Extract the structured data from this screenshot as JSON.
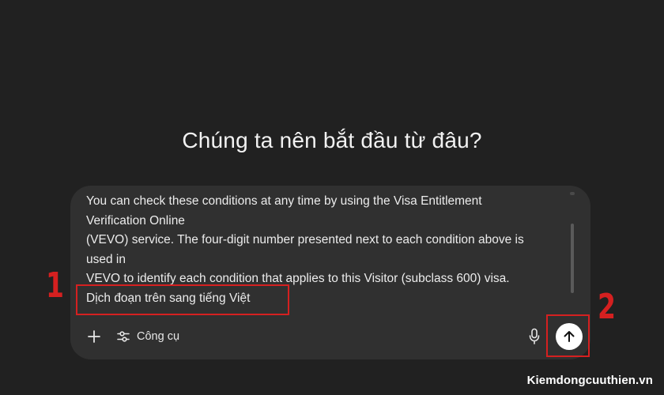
{
  "main": {
    "heading": "Chúng ta nên bắt đầu từ đâu?"
  },
  "composer": {
    "prompt_lines": [
      "You can check these conditions at any time by using the Visa Entitlement",
      "Verification Online",
      "(VEVO) service. The four-digit number presented next to each condition above is",
      "used in",
      "VEVO to identify each condition that applies to this Visitor (subclass 600) visa.",
      "Dịch đoạn trên sang tiếng Việt"
    ],
    "tools_label": "Công cụ",
    "icons": {
      "add": "plus-icon",
      "tools": "sliders-icon",
      "mic": "microphone-icon",
      "send": "arrow-up-icon"
    }
  },
  "annotations": {
    "step_1": "1",
    "step_2": "2",
    "color": "#d52020"
  },
  "watermark": "Kiemdongcuuthien.vn",
  "colors": {
    "background": "#212121",
    "composer": "#303030",
    "send_button": "#ffffff"
  }
}
